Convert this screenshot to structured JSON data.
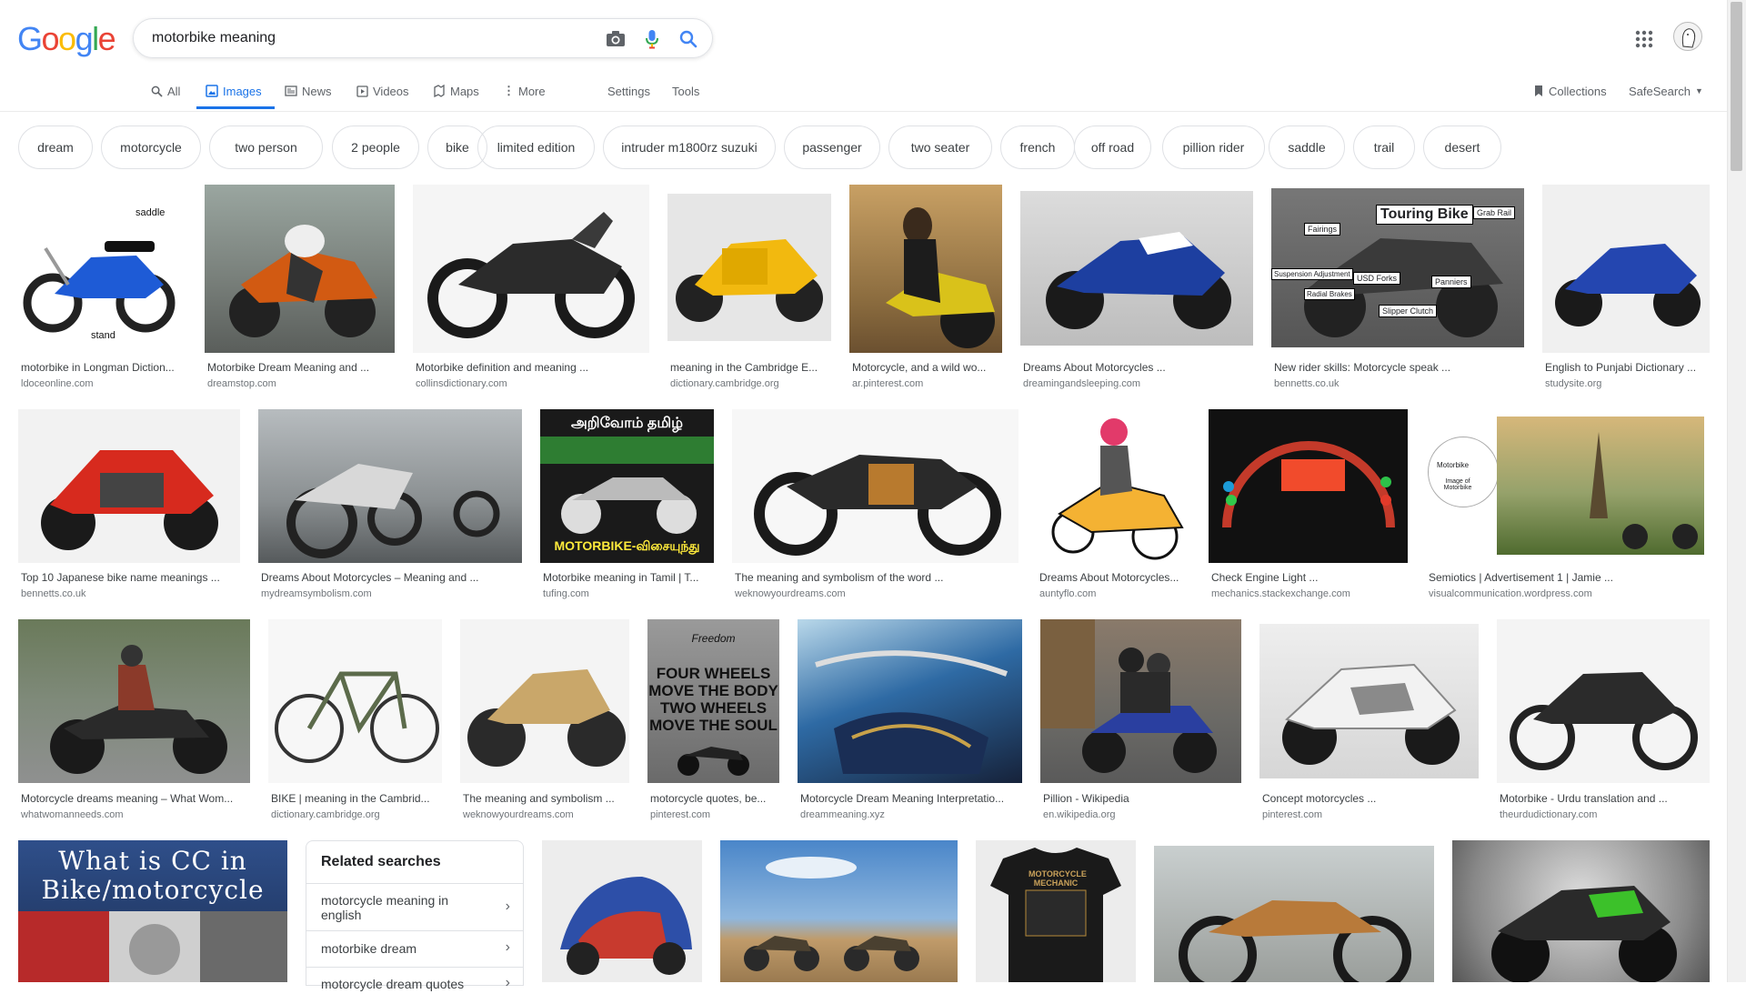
{
  "logo": {
    "text": "Google"
  },
  "search": {
    "query": "motorbike meaning"
  },
  "tabs": [
    "All",
    "Images",
    "News",
    "Videos",
    "Maps",
    "More"
  ],
  "tools": {
    "settings": "Settings",
    "tools": "Tools",
    "collections": "Collections",
    "safesearch": "SafeSearch"
  },
  "chips": [
    "dream",
    "motorcycle",
    "two person",
    "2 people",
    "bike",
    "limited edition",
    "intruder m1800rz suzuki",
    "passenger",
    "two seater",
    "french",
    "off road",
    "pillion rider",
    "saddle",
    "trail",
    "desert"
  ],
  "results": [
    {
      "title": "motorbike in Longman Diction...",
      "source": "ldoceonline.com",
      "labels": [
        "saddle",
        "stand"
      ]
    },
    {
      "title": "Motorbike Dream Meaning and ...",
      "source": "dreamstop.com"
    },
    {
      "title": "Motorbike definition and meaning ...",
      "source": "collinsdictionary.com"
    },
    {
      "title": "meaning in the Cambridge E...",
      "source": "dictionary.cambridge.org"
    },
    {
      "title": "Motorcycle, and a wild wo...",
      "source": "ar.pinterest.com"
    },
    {
      "title": "Dreams About Motorcycles ...",
      "source": "dreamingandsleeping.com"
    },
    {
      "title": "New rider skills: Motorcycle speak ...",
      "source": "bennetts.co.uk",
      "labels": [
        "Touring Bike",
        "Grab Rail",
        "Fairings",
        "Suspension Adjustment",
        "USD Forks",
        "Panniers",
        "Radial Brakes",
        "Slipper Clutch"
      ]
    },
    {
      "title": "English to Punjabi Dictionary ...",
      "source": "studysite.org"
    },
    {
      "title": "Top 10 Japanese bike name meanings ...",
      "source": "bennetts.co.uk"
    },
    {
      "title": "Dreams About Motorcycles – Meaning and ...",
      "source": "mydreamsymbolism.com"
    },
    {
      "title": "Motorbike meaning in Tamil | T...",
      "source": "tufing.com",
      "labels": [
        "அறிவோம் தமிழ்",
        "MOTORBIKE-விசையுந்து"
      ]
    },
    {
      "title": "The meaning and symbolism of the word ...",
      "source": "weknowyourdreams.com"
    },
    {
      "title": "Dreams About Motorcycles...",
      "source": "auntyflo.com"
    },
    {
      "title": "Check Engine Light ...",
      "source": "mechanics.stackexchange.com"
    },
    {
      "title": "Semiotics | Advertisement 1 | Jamie ...",
      "source": "visualcommunication.wordpress.com",
      "labels": [
        "Motorbike",
        "Image of Motorbike"
      ]
    },
    {
      "title": "Motorcycle dreams meaning – What Wom...",
      "source": "whatwomanneeds.com"
    },
    {
      "title": "BIKE | meaning in the Cambrid...",
      "source": "dictionary.cambridge.org"
    },
    {
      "title": "The meaning and symbolism ...",
      "source": "weknowyourdreams.com"
    },
    {
      "title": "motorcycle quotes, be...",
      "source": "pinterest.com",
      "labels": [
        "Freedom",
        "FOUR WHEELS",
        "MOVE THE BODY",
        "TWO WHEELS",
        "MOVE THE SOUL"
      ]
    },
    {
      "title": "Motorcycle Dream Meaning Interpretatio...",
      "source": "dreammeaning.xyz"
    },
    {
      "title": "Pillion - Wikipedia",
      "source": "en.wikipedia.org"
    },
    {
      "title": "Concept motorcycles ...",
      "source": "pinterest.com"
    },
    {
      "title": "Motorbike - Urdu translation and ...",
      "source": "theurdudictionary.com"
    }
  ],
  "row4": {
    "cc_text_1": "What is CC in",
    "cc_text_2": "Bike/motorcycle",
    "tshirt_text": "MOTORCYCLE MECHANIC"
  },
  "related": {
    "title": "Related searches",
    "items": [
      "motorcycle meaning in english",
      "motorbike dream",
      "motorcycle dream quotes"
    ]
  }
}
